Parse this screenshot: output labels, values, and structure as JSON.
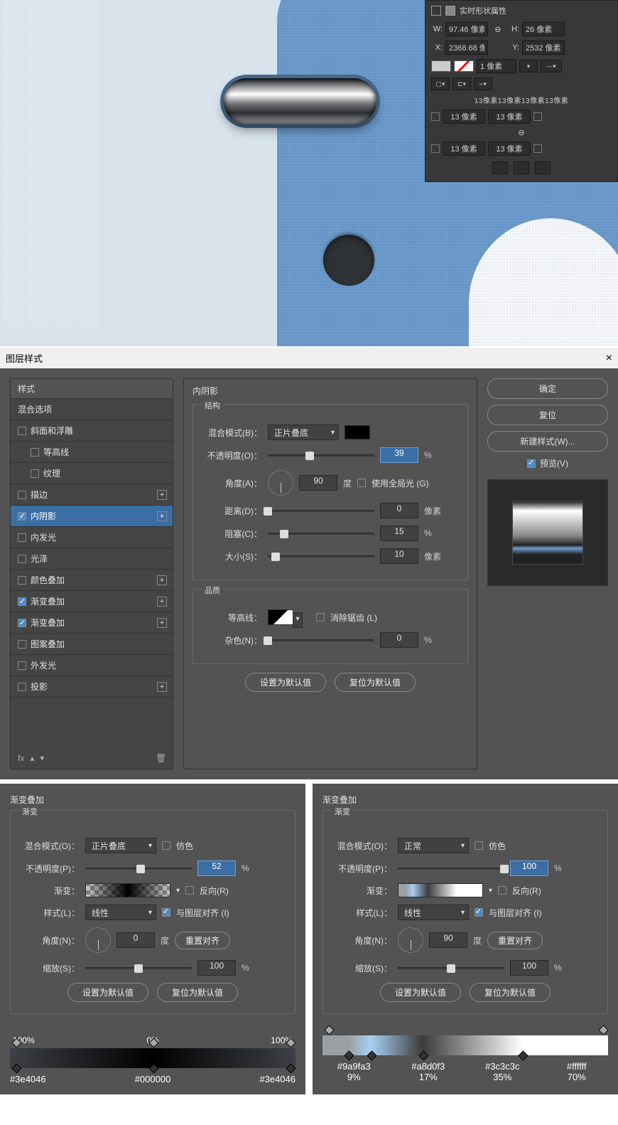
{
  "propPanel": {
    "title": "实时形状属性",
    "wLabel": "W:",
    "wVal": "97.46 像素",
    "link": "⊖",
    "hLabel": "H:",
    "hVal": "26 像素",
    "xLabel": "X:",
    "xVal": "2368.68 像",
    "yLabel": "Y:",
    "yVal": "2532 像素",
    "strokeVal": "1 像素",
    "cornersText": "13像素13像素13像素13像素",
    "c1": "13 像素",
    "c2": "13 像素",
    "c3": "13 像素",
    "c4": "13 像素",
    "cornerLink": "⊖"
  },
  "dialog": {
    "title": "图层样式",
    "closeX": "×",
    "stylesHeader": "样式",
    "items": [
      {
        "label": "混合选项",
        "check": false,
        "noBox": true
      },
      {
        "label": "斜面和浮雕",
        "check": false
      },
      {
        "label": "等高线",
        "check": false,
        "indent": true
      },
      {
        "label": "纹理",
        "check": false,
        "indent": true
      },
      {
        "label": "描边",
        "check": false,
        "add": true
      },
      {
        "label": "内阴影",
        "check": true,
        "active": true,
        "add": true
      },
      {
        "label": "内发光",
        "check": false
      },
      {
        "label": "光泽",
        "check": false
      },
      {
        "label": "颜色叠加",
        "check": false,
        "add": true
      },
      {
        "label": "渐变叠加",
        "check": true,
        "add": true
      },
      {
        "label": "渐变叠加",
        "check": true,
        "add": true
      },
      {
        "label": "图案叠加",
        "check": false
      },
      {
        "label": "外发光",
        "check": false
      },
      {
        "label": "投影",
        "check": false,
        "add": true
      }
    ],
    "fxLabel": "fx",
    "sectionTitle": "内阴影",
    "group1": "结构",
    "blendLabel": "混合模式(B)：",
    "blendVal": "正片叠底",
    "opacityLabel": "不透明度(O)：",
    "opacityVal": "39",
    "opacityUnit": "%",
    "angleLabel": "角度(A)：",
    "angleVal": "90",
    "angleUnit": "度",
    "globalLight": "使用全局光 (G)",
    "distLabel": "距离(D)：",
    "distVal": "0",
    "distUnit": "像素",
    "chokeLabel": "阻塞(C)：",
    "chokeVal": "15",
    "chokeUnit": "%",
    "sizeLabel": "大小(S)：",
    "sizeVal": "10",
    "sizeUnit": "像素",
    "group2": "品质",
    "contourLabel": "等高线：",
    "antiAlias": "消除锯齿 (L)",
    "noiseLabel": "杂色(N)：",
    "noiseVal": "0",
    "noiseUnit": "%",
    "setDefault": "设置为默认值",
    "resetDefault": "复位为默认值",
    "ok": "确定",
    "reset": "复位",
    "newStyle": "新建样式(W)...",
    "preview": "预览(V)"
  },
  "grad1": {
    "title": "渐变叠加",
    "sub": "渐变",
    "blendLabel": "混合模式(O)：",
    "blendVal": "正片叠底",
    "dither": "仿色",
    "opacityLabel": "不透明度(P)：",
    "opacityVal": "52",
    "opacityUnit": "%",
    "gradLabel": "渐变：",
    "reverse": "反向(R)",
    "styleLabel": "样式(L)：",
    "styleVal": "线性",
    "align": "与图层对齐 (I)",
    "angleLabel": "角度(N)：",
    "angleVal": "0",
    "angleUnit": "度",
    "resetAlign": "重置对齐",
    "scaleLabel": "缩放(S)：",
    "scaleVal": "100",
    "scaleUnit": "%",
    "setDefault": "设置为默认值",
    "resetDefault": "复位为默认值",
    "op1": "100%",
    "op2": "0%",
    "op3": "100%",
    "c1": "#3e4046",
    "c2": "#000000",
    "c3": "#3e4046"
  },
  "grad2": {
    "title": "渐变叠加",
    "sub": "渐变",
    "blendLabel": "混合模式(O)：",
    "blendVal": "正常",
    "dither": "仿色",
    "opacityLabel": "不透明度(P)：",
    "opacityVal": "100",
    "opacityUnit": "%",
    "gradLabel": "渐变：",
    "reverse": "反向(R)",
    "styleLabel": "样式(L)：",
    "styleVal": "线性",
    "align": "与图层对齐 (I)",
    "angleLabel": "角度(N)：",
    "angleVal": "90",
    "angleUnit": "度",
    "resetAlign": "重置对齐",
    "scaleLabel": "缩放(S)：",
    "scaleVal": "100",
    "scaleUnit": "%",
    "setDefault": "设置为默认值",
    "resetDefault": "复位为默认值",
    "s1": "#9a9fa3",
    "p1": "9%",
    "s2": "#a8d0f3",
    "p2": "17%",
    "s3": "#3c3c3c",
    "p3": "35%",
    "s4": "#ffffff",
    "p4": "70%"
  }
}
